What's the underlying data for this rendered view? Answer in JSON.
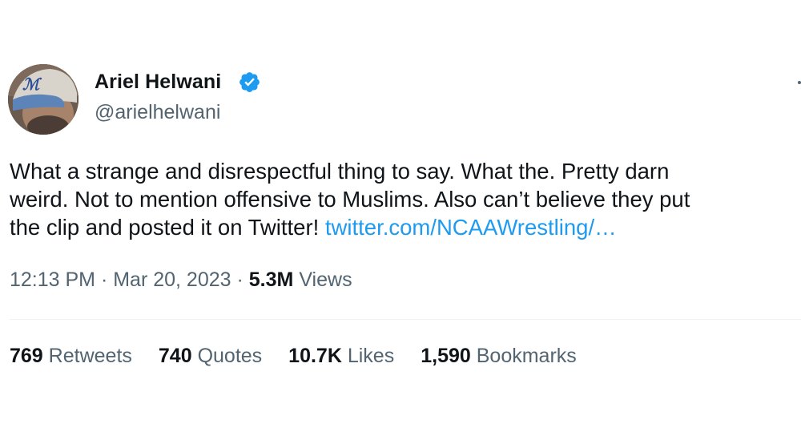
{
  "author": {
    "display_name": "Ariel Helwani",
    "handle": "@arielhelwani",
    "verified": true,
    "verified_color": "#1d9bf0"
  },
  "tweet": {
    "text_lines": [
      "What a strange and disrespectful thing to say. What the. Pretty darn",
      "weird. Not to mention offensive to Muslims. Also can’t believe they put",
      "the clip and posted it on Twitter! "
    ],
    "link_text": "twitter.com/NCAAWrestling/…",
    "link_color": "#1d9bf0"
  },
  "meta": {
    "time": "12:13 PM",
    "separator": " · ",
    "date": "Mar 20, 2023",
    "views_count": "5.3M",
    "views_label": "Views"
  },
  "stats": [
    {
      "count": "769",
      "label": "Retweets"
    },
    {
      "count": "740",
      "label": "Quotes"
    },
    {
      "count": "10.7K",
      "label": "Likes"
    },
    {
      "count": "1,590",
      "label": "Bookmarks"
    }
  ],
  "colors": {
    "text": "#0f1419",
    "secondary": "#536471",
    "divider": "#eff3f4"
  }
}
